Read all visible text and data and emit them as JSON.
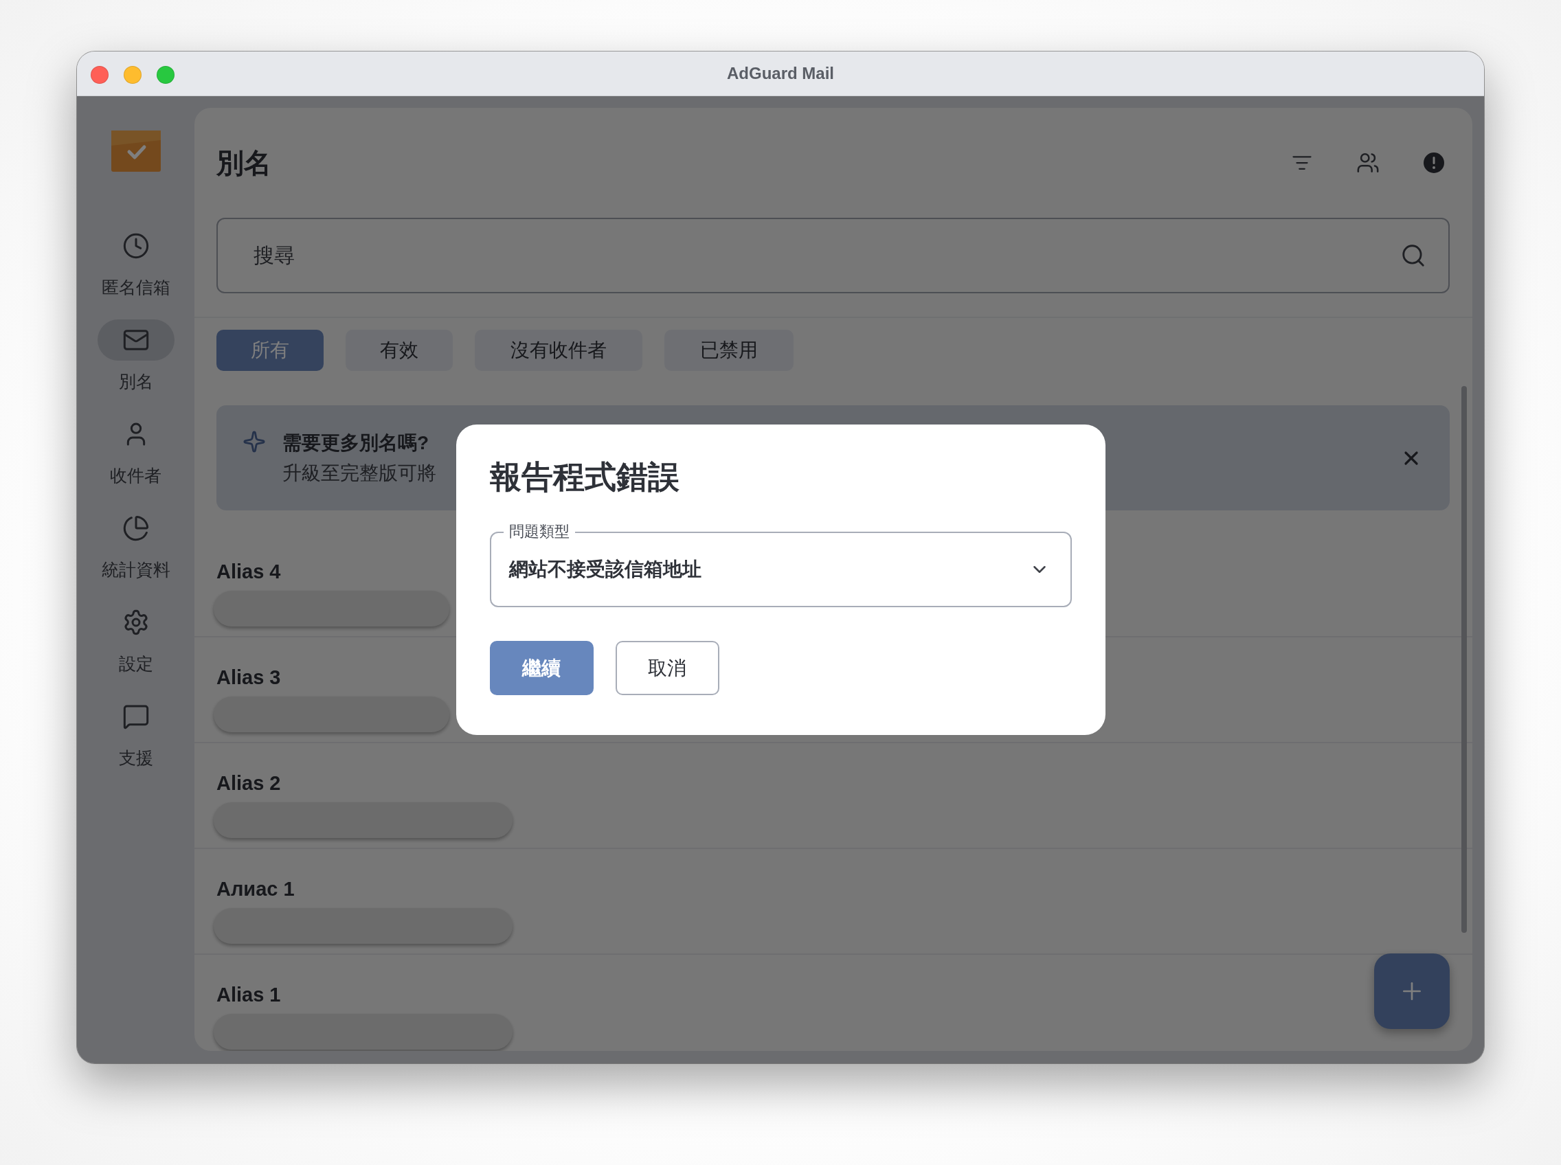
{
  "window": {
    "title": "AdGuard Mail"
  },
  "sidebar": {
    "items": [
      {
        "label": "匿名信箱",
        "selected": false
      },
      {
        "label": "別名",
        "selected": true
      },
      {
        "label": "收件者",
        "selected": false
      },
      {
        "label": "統計資料",
        "selected": false
      },
      {
        "label": "設定",
        "selected": false
      },
      {
        "label": "支援",
        "selected": false
      }
    ]
  },
  "header": {
    "title": "別名"
  },
  "search": {
    "placeholder": "搜尋"
  },
  "filters": [
    {
      "label": "所有",
      "selected": true
    },
    {
      "label": "有效",
      "selected": false
    },
    {
      "label": "沒有收件者",
      "selected": false
    },
    {
      "label": "已禁用",
      "selected": false
    }
  ],
  "banner": {
    "title": "需要更多別名嗎?",
    "text": "升級至完整版可將"
  },
  "aliases": [
    {
      "name": "Alias 4"
    },
    {
      "name": "Alias 3"
    },
    {
      "name": "Alias 2"
    },
    {
      "name": "Алиас 1"
    },
    {
      "name": "Alias 1"
    }
  ],
  "dialog": {
    "title": "報告程式錯誤",
    "field": {
      "label": "問題類型",
      "value": "網站不接受該信箱地址"
    },
    "buttons": [
      {
        "label": "繼續",
        "kind": "primary"
      },
      {
        "label": "取消",
        "kind": "secondary"
      }
    ]
  }
}
